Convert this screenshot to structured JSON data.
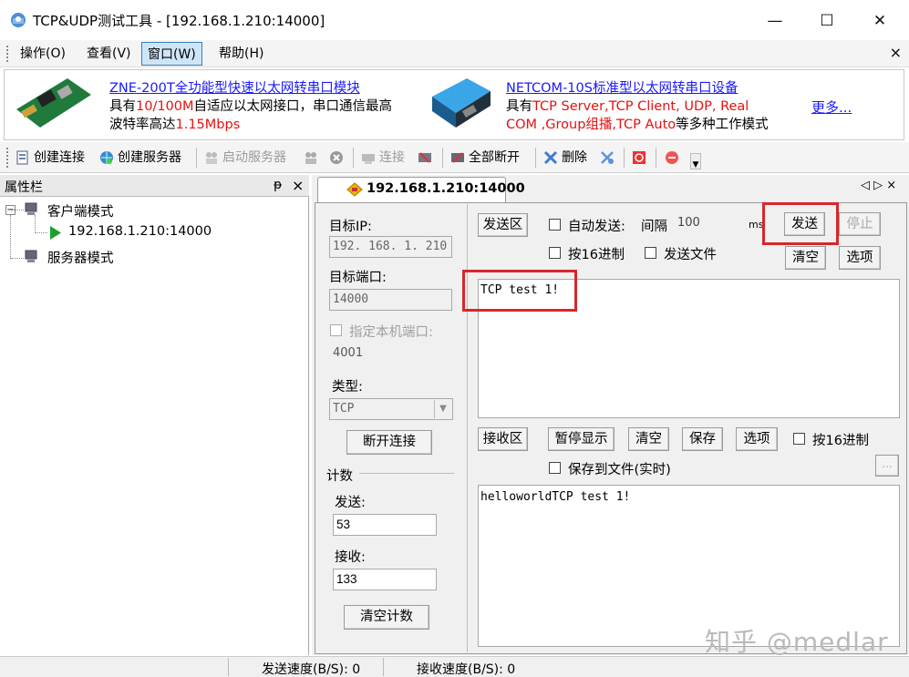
{
  "window": {
    "title": "TCP&UDP测试工具 - [192.168.1.210:14000]"
  },
  "menu": {
    "items": [
      "操作(O)",
      "查看(V)",
      "窗口(W)",
      "帮助(H)"
    ],
    "active": "窗口(W)",
    "close": "×"
  },
  "ads": {
    "left": {
      "title": "ZNE-200T全功能型快速以太网转串口模块",
      "l2a": "具有",
      "l2b": "10/100M",
      "l2c": "自适应以太网接口，串口通信最高",
      "l3a": "波特率高达",
      "l3b": "1.15Mbps"
    },
    "right": {
      "title": "NETCOM-10S标准型以太网转串口设备",
      "l2a": "具有",
      "l2b": "TCP Server,TCP Client, UDP, Real",
      "l3a": "COM ,Group组播,TCP Auto",
      "l3b": "等多种工作模式"
    },
    "more": "更多..."
  },
  "toolbar": {
    "create_conn": "创建连接",
    "create_server": "创建服务器",
    "start_server": "启动服务器",
    "connect": "连接",
    "disconnect_all": "全部断开",
    "delete": "删除"
  },
  "left_panel": {
    "title": "属性栏",
    "pin": "ᵽ",
    "close": "×",
    "tree": {
      "client_mode": "客户端模式",
      "conn": "192.168.1.210:14000",
      "server_mode": "服务器模式"
    }
  },
  "tab": {
    "label": "192.168.1.210:14000",
    "nav": "◁ ▷ ×"
  },
  "settings": {
    "target_ip_label": "目标IP:",
    "target_ip": "192. 168. 1. 210",
    "target_port_label": "目标端口:",
    "target_port": "14000",
    "local_port_label": "指定本机端口:",
    "local_port": "4001",
    "type_label": "类型:",
    "type_value": "TCP",
    "disconnect_btn": "断开连接",
    "count_label": "计数",
    "send_label": "发送:",
    "send_count": "53",
    "recv_label": "接收:",
    "recv_count": "133",
    "clear_count_btn": "清空计数"
  },
  "send_area": {
    "label": "发送区",
    "auto_send": "自动发送:",
    "interval_label": "间隔",
    "interval_value": "100",
    "interval_unit": "ms",
    "send_btn": "发送",
    "stop_btn": "停止",
    "hex": "按16进制",
    "send_file": "发送文件",
    "clear_btn": "清空",
    "options_btn": "选项",
    "text": "TCP test 1!"
  },
  "recv_area": {
    "label": "接收区",
    "pause_btn": "暂停显示",
    "clear_btn": "清空",
    "save_btn": "保存",
    "options_btn": "选项",
    "hex": "按16进制",
    "save_file": "保存到文件(实时)",
    "browse_btn": "...",
    "text": "helloworldTCP test 1!"
  },
  "status": {
    "send_speed": "发送速度(B/S): 0",
    "recv_speed": "接收速度(B/S): 0"
  },
  "watermark": "知乎 @medlar",
  "colors": {
    "highlight": "#d9262a",
    "link": "#1a1aff",
    "accent_red": "#e81010"
  }
}
